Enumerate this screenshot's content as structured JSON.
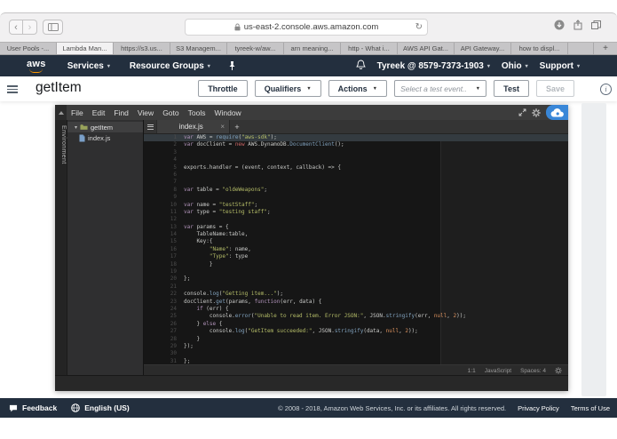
{
  "browser": {
    "url": "us-east-2.console.aws.amazon.com",
    "tabs": [
      {
        "label": "User Pools -...",
        "active": false
      },
      {
        "label": "Lambda Man...",
        "active": true
      },
      {
        "label": "https://s3.us...",
        "active": false
      },
      {
        "label": "S3 Managem...",
        "active": false
      },
      {
        "label": "tyreek-w/aw...",
        "active": false
      },
      {
        "label": "arn meaning...",
        "active": false
      },
      {
        "label": "http - What i...",
        "active": false
      },
      {
        "label": "AWS API Gat...",
        "active": false
      },
      {
        "label": "API Gateway...",
        "active": false
      },
      {
        "label": "how to displ...",
        "active": false
      }
    ]
  },
  "aws_nav": {
    "logo": "aws",
    "menus": [
      "Services",
      "Resource Groups"
    ],
    "account": "Tyreek @ 8579-7373-1903",
    "region": "Ohio",
    "support": "Support"
  },
  "function_header": {
    "title": "getItem",
    "buttons": [
      {
        "label": "Throttle",
        "caret": false
      },
      {
        "label": "Qualifiers",
        "caret": true
      },
      {
        "label": "Actions",
        "caret": true
      }
    ],
    "test_event_placeholder": "Select a test event..",
    "test_label": "Test",
    "save_label": "Save"
  },
  "editor": {
    "menu_items": [
      "File",
      "Edit",
      "Find",
      "View",
      "Goto",
      "Tools",
      "Window"
    ],
    "environment_label": "Environment",
    "tree": {
      "folder": "getItem",
      "file": "index.js"
    },
    "tab": "index.js",
    "status": {
      "cursor": "1:1",
      "language": "JavaScript",
      "spaces": "Spaces: 4"
    },
    "code": {
      "active_line": 1,
      "lines": [
        [
          [
            "k",
            "var"
          ],
          [
            "p",
            " AWS = "
          ],
          [
            "f",
            "require"
          ],
          [
            "p",
            "("
          ],
          [
            "s",
            "\"aws-sdk\""
          ],
          [
            "p",
            ");"
          ]
        ],
        [
          [
            "k",
            "var"
          ],
          [
            "p",
            " docClient = "
          ],
          [
            "n",
            "new"
          ],
          [
            "p",
            " AWS.DynamoDB."
          ],
          [
            "f",
            "DocumentClient"
          ],
          [
            "p",
            "();"
          ]
        ],
        [],
        [],
        [
          [
            "p",
            "exports.handler = (event, context, callback) => {"
          ]
        ],
        [],
        [],
        [
          [
            "k",
            "var"
          ],
          [
            "p",
            " table = "
          ],
          [
            "s",
            "\"oldeWeapons\""
          ],
          [
            "p",
            ";"
          ]
        ],
        [],
        [
          [
            "k",
            "var"
          ],
          [
            "p",
            " name = "
          ],
          [
            "s",
            "\"testStaff\""
          ],
          [
            "p",
            ";"
          ]
        ],
        [
          [
            "k",
            "var"
          ],
          [
            "p",
            " type = "
          ],
          [
            "s",
            "\"testing staff\""
          ],
          [
            "p",
            ";"
          ]
        ],
        [],
        [
          [
            "k",
            "var"
          ],
          [
            "p",
            " params = {"
          ]
        ],
        [
          [
            "p",
            "    TableName:table,"
          ]
        ],
        [
          [
            "p",
            "    Key:{"
          ]
        ],
        [
          [
            "p",
            "        "
          ],
          [
            "s",
            "\"Name\""
          ],
          [
            "p",
            ": name,"
          ]
        ],
        [
          [
            "p",
            "        "
          ],
          [
            "s",
            "\"Type\""
          ],
          [
            "p",
            ": type"
          ]
        ],
        [
          [
            "p",
            "        }"
          ]
        ],
        [],
        [
          [
            "p",
            "};"
          ]
        ],
        [],
        [
          [
            "p",
            "console."
          ],
          [
            "f",
            "log"
          ],
          [
            "p",
            "("
          ],
          [
            "s",
            "\"Getting item...\""
          ],
          [
            "p",
            ");"
          ]
        ],
        [
          [
            "p",
            "docClient."
          ],
          [
            "f",
            "get"
          ],
          [
            "p",
            "(params, "
          ],
          [
            "k",
            "function"
          ],
          [
            "p",
            "(err, data) {"
          ]
        ],
        [
          [
            "p",
            "    "
          ],
          [
            "k",
            "if"
          ],
          [
            "p",
            " (err) {"
          ]
        ],
        [
          [
            "p",
            "        console."
          ],
          [
            "f",
            "error"
          ],
          [
            "p",
            "("
          ],
          [
            "s",
            "\"Unable to read item. Error JSON:\""
          ],
          [
            "p",
            ", JSON."
          ],
          [
            "f",
            "stringify"
          ],
          [
            "p",
            "(err, "
          ],
          [
            "o",
            "null"
          ],
          [
            "p",
            ", "
          ],
          [
            "o",
            "2"
          ],
          [
            "p",
            "));"
          ]
        ],
        [
          [
            "p",
            "    } "
          ],
          [
            "k",
            "else"
          ],
          [
            "p",
            " {"
          ]
        ],
        [
          [
            "p",
            "        console."
          ],
          [
            "f",
            "log"
          ],
          [
            "p",
            "("
          ],
          [
            "s",
            "\"GetItem succeeded:\""
          ],
          [
            "p",
            ", JSON."
          ],
          [
            "f",
            "stringify"
          ],
          [
            "p",
            "(data, "
          ],
          [
            "o",
            "null"
          ],
          [
            "p",
            ", "
          ],
          [
            "o",
            "2"
          ],
          [
            "p",
            "));"
          ]
        ],
        [
          [
            "p",
            "    }"
          ]
        ],
        [
          [
            "p",
            "});"
          ]
        ],
        [],
        [
          [
            "p",
            "};"
          ]
        ]
      ]
    }
  },
  "footer": {
    "feedback": "Feedback",
    "language": "English (US)",
    "copyright": "© 2008 - 2018, Amazon Web Services, Inc. or its affiliates. All rights reserved.",
    "privacy": "Privacy Policy",
    "terms": "Terms of Use"
  },
  "icons": {
    "back": "‹",
    "forward": "›",
    "refresh": "↻",
    "close": "×",
    "plus": "+",
    "caret_down": "▼"
  },
  "colors": {
    "nav_bg": "#232f3e",
    "aws_orange": "#ff9900",
    "cloud9_blue": "#3987d8",
    "code_bg": "#161616",
    "keyword": "#b294bb",
    "string": "#b5bd68",
    "function": "#81a2be",
    "constant": "#de935f",
    "new_keyword": "#cc6666"
  }
}
